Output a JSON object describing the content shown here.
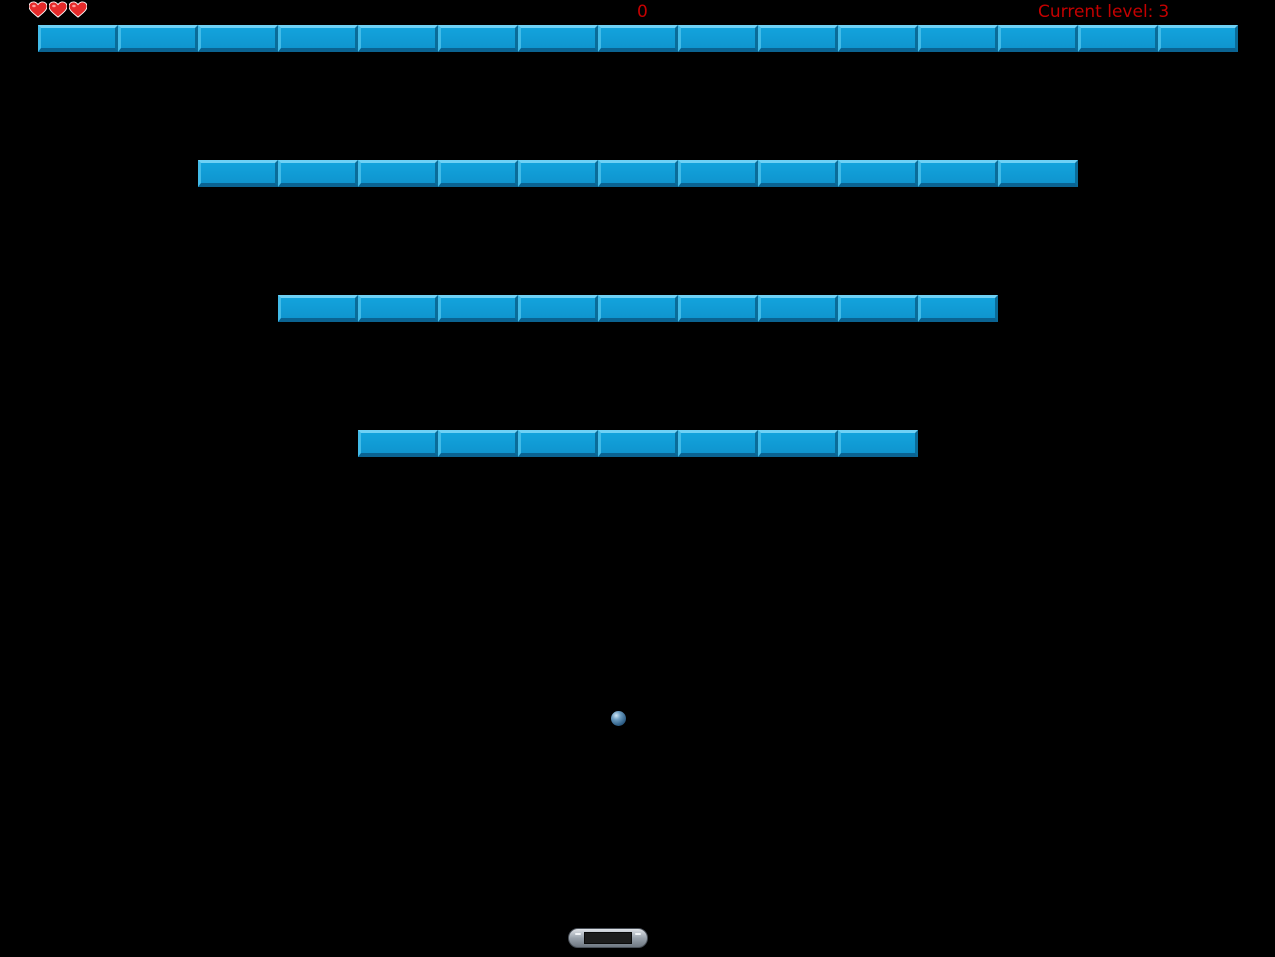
{
  "hud": {
    "lives": 3,
    "score": "0",
    "level_label": "Current level:",
    "level_value": "3"
  },
  "colors": {
    "hud_text": "#c40000",
    "heart": "#e52a2a",
    "brick": "#13a3dc",
    "background": "#000000"
  },
  "icons": {
    "life": "heart-icon"
  },
  "bricks": {
    "rows": [
      {
        "count": 15
      },
      {
        "count": 11
      },
      {
        "count": 9
      },
      {
        "count": 7
      }
    ]
  }
}
